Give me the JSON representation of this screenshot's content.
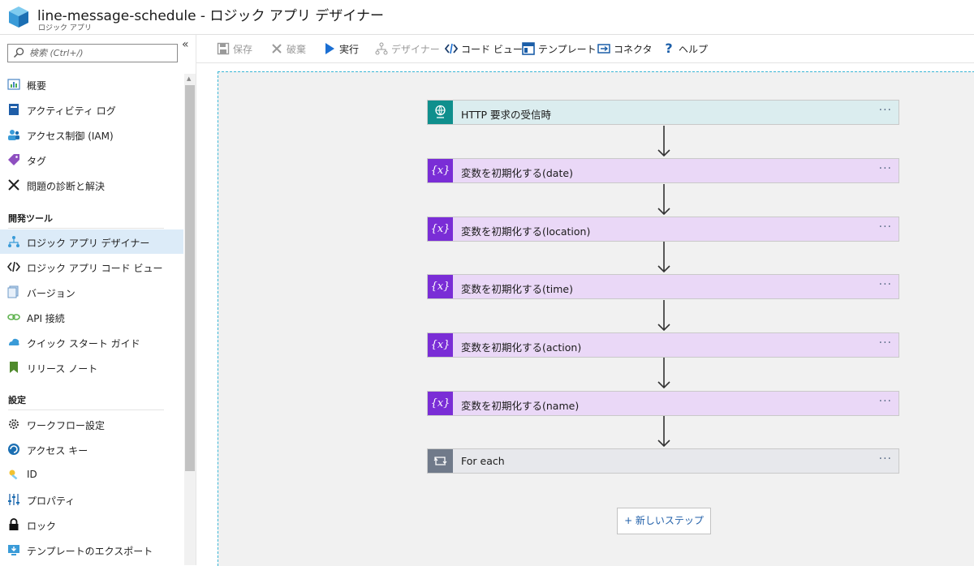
{
  "header": {
    "title": "line-message-schedule - ロジック アプリ デザイナー",
    "subtitle": "ロジック アプリ"
  },
  "search": {
    "placeholder": "検索 (Ctrl+/)"
  },
  "sidebar": {
    "collapse_glyph": "«",
    "items": [
      {
        "label": "概要",
        "icon": "overview-icon"
      },
      {
        "label": "アクティビティ ログ",
        "icon": "activity-log-icon"
      },
      {
        "label": "アクセス制御 (IAM)",
        "icon": "iam-icon"
      },
      {
        "label": "タグ",
        "icon": "tag-icon"
      },
      {
        "label": "問題の診断と解決",
        "icon": "wrench-icon"
      }
    ],
    "dev_section": "開発ツール",
    "dev_items": [
      {
        "label": "ロジック アプリ デザイナー",
        "icon": "designer-icon",
        "active": true
      },
      {
        "label": "ロジック アプリ コード ビュー",
        "icon": "code-icon"
      },
      {
        "label": "バージョン",
        "icon": "version-icon"
      },
      {
        "label": "API 接続",
        "icon": "api-connection-icon"
      },
      {
        "label": "クイック スタート ガイド",
        "icon": "quickstart-icon"
      },
      {
        "label": "リリース ノート",
        "icon": "release-notes-icon"
      }
    ],
    "settings_section": "設定",
    "settings_items": [
      {
        "label": "ワークフロー設定",
        "icon": "gear-icon"
      },
      {
        "label": "アクセス キー",
        "icon": "access-key-icon"
      },
      {
        "label": "ID",
        "icon": "identity-icon"
      },
      {
        "label": "プロパティ",
        "icon": "properties-icon"
      },
      {
        "label": "ロック",
        "icon": "lock-icon"
      },
      {
        "label": "テンプレートのエクスポート",
        "icon": "export-template-icon"
      }
    ]
  },
  "toolbar": {
    "save": "保存",
    "discard": "破棄",
    "run": "実行",
    "designer": "デザイナー",
    "code_view": "コード ビュー",
    "templates": "テンプレート",
    "connectors": "コネクタ",
    "help": "ヘルプ"
  },
  "workflow": {
    "steps": [
      {
        "label": "HTTP 要求の受信時",
        "type": "trigger"
      },
      {
        "label": "変数を初期化する(date)",
        "type": "variable"
      },
      {
        "label": "変数を初期化する(location)",
        "type": "variable"
      },
      {
        "label": "変数を初期化する(time)",
        "type": "variable"
      },
      {
        "label": "変数を初期化する(action)",
        "type": "variable"
      },
      {
        "label": "変数を初期化する(name)",
        "type": "variable"
      },
      {
        "label": "For each",
        "type": "loop"
      }
    ],
    "more_glyph": "···",
    "variable_icon_text": "{x}",
    "new_step": "+ 新しいステップ"
  },
  "colors": {
    "trigger_icon": "#0f8f8d",
    "variable_icon": "#7a2dd6",
    "loop_icon": "#707a8a",
    "accent": "#0078d4"
  }
}
